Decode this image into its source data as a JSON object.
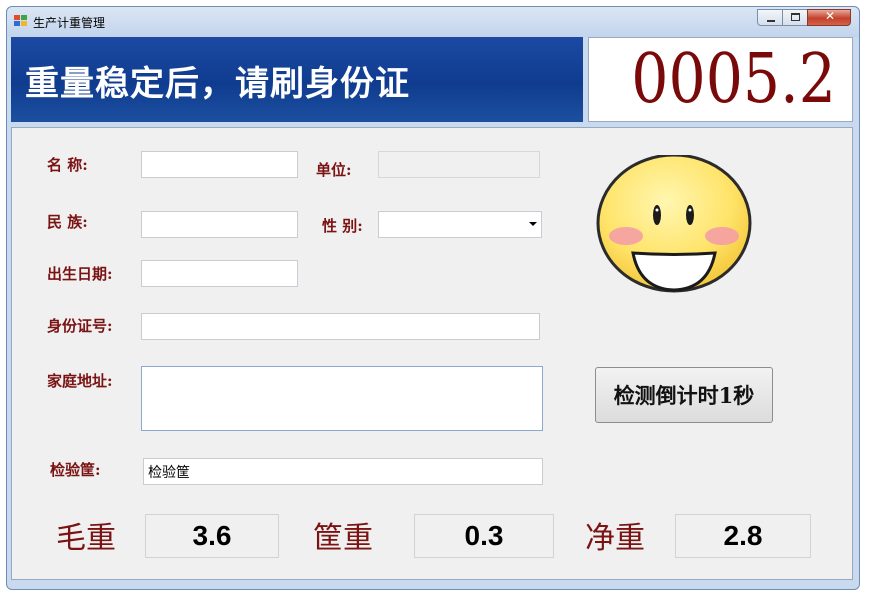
{
  "window": {
    "title": "生产计重管理"
  },
  "header": {
    "prompt": "重量稳定后，请刷身份证",
    "weight_reading": "0005.2"
  },
  "form": {
    "name": {
      "label": "名  称:",
      "value": ""
    },
    "unit": {
      "label": "单位:",
      "value": ""
    },
    "ethnicity": {
      "label": "民  族:",
      "value": ""
    },
    "gender": {
      "label": "性  别:",
      "value": ""
    },
    "birthdate": {
      "label": "出生日期:",
      "value": ""
    },
    "id_number": {
      "label": "身份证号:",
      "value": ""
    },
    "address": {
      "label": "家庭地址:",
      "value": ""
    },
    "basket": {
      "label": "检验筐:",
      "value": "检验筐"
    }
  },
  "countdown_button": {
    "label": "检测倒计时1秒"
  },
  "weights": {
    "gross": {
      "label": "毛重",
      "value": "3.6"
    },
    "basket": {
      "label": "筐重",
      "value": "0.3"
    },
    "net": {
      "label": "净重",
      "value": "2.8"
    }
  },
  "icons": {
    "app": "app-icon",
    "status": "smiley-face-icon"
  }
}
